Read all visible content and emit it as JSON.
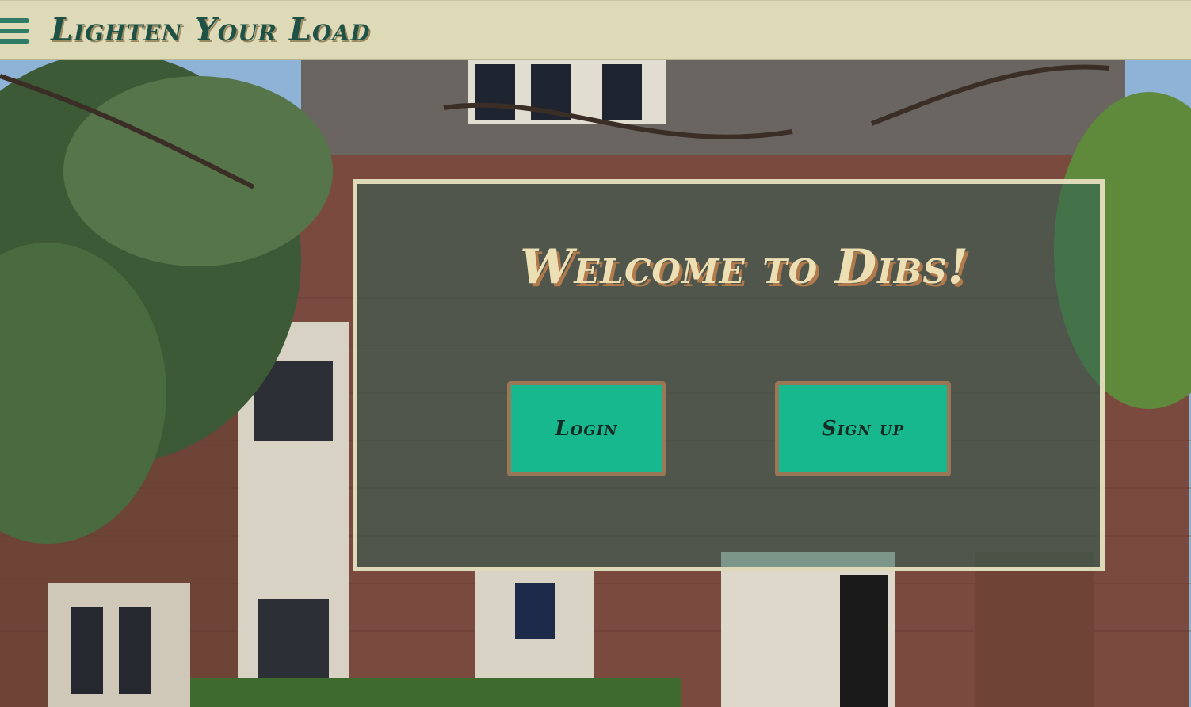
{
  "header": {
    "menu_icon": "hamburger-menu-icon",
    "title": "Lighten Your Load"
  },
  "background": {
    "image": "mansion-photo"
  },
  "panel": {
    "heading": "Welcome to Dibs!",
    "login_label": "Login",
    "signup_label": "Sign up"
  },
  "colors": {
    "header_bg": "#dedab8",
    "brand_text": "#1f5247",
    "accent_teal": "#17b88d",
    "button_border": "#9a7757",
    "panel_border": "#ddd9b9",
    "heading_text": "#ecdfb4",
    "heading_shadow": "#b07a4c"
  }
}
